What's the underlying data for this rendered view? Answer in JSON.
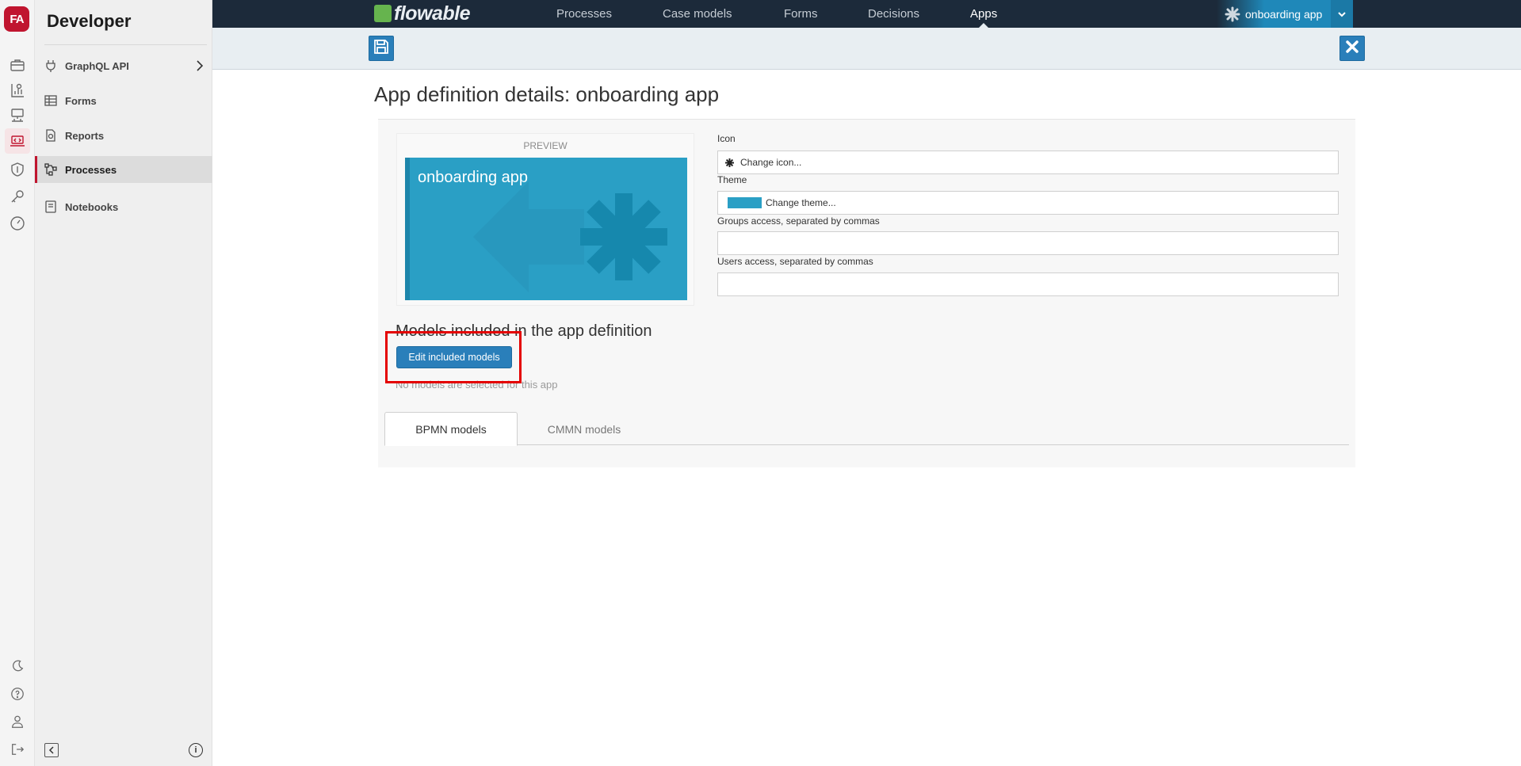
{
  "rail": {
    "logo_text": "FA",
    "items": [
      "briefcase-icon",
      "report-chart-icon",
      "process-network-icon",
      "developer-laptop-icon",
      "shield-icon",
      "key-icon",
      "speedometer-icon"
    ],
    "bottom_items": [
      "moon-icon",
      "help-icon",
      "user-icon",
      "logout-icon"
    ]
  },
  "sidebar": {
    "title": "Developer",
    "items": [
      {
        "label": "GraphQL API",
        "icon": "plug-icon"
      },
      {
        "label": "Forms",
        "icon": "table-icon"
      },
      {
        "label": "Reports",
        "icon": "report-icon"
      },
      {
        "label": "Processes",
        "icon": "process-icon"
      },
      {
        "label": "Notebooks",
        "icon": "notebook-icon"
      }
    ],
    "active_item": "Processes"
  },
  "topbar": {
    "brand": "flowable",
    "nav": [
      "Processes",
      "Case models",
      "Forms",
      "Decisions",
      "Apps"
    ],
    "active_nav": "Apps",
    "app_selector": "onboarding app"
  },
  "toolbar": {
    "save_icon": "save-icon",
    "close_icon": "close-icon"
  },
  "main": {
    "heading": "App definition details: onboarding app",
    "preview_label": "PREVIEW",
    "preview_tile_name": "onboarding app",
    "fields": {
      "icon_label": "Icon",
      "icon_value": "Change icon...",
      "theme_label": "Theme",
      "theme_value": "Change theme...",
      "theme_color": "#2a9fc5",
      "groups_label": "Groups access, separated by commas",
      "groups_value": "",
      "users_label": "Users access, separated by commas",
      "users_value": ""
    },
    "models_title": "Models included in the app definition",
    "edit_button": "Edit included models",
    "no_models": "No models are selected for this app",
    "tabs": [
      "BPMN models",
      "CMMN models"
    ],
    "active_tab": "BPMN models"
  },
  "colors": {
    "brand_red": "#c0152f",
    "topbar": "#1c2a3a",
    "primary_blue": "#2a7fba",
    "highlight": "#e40000"
  }
}
